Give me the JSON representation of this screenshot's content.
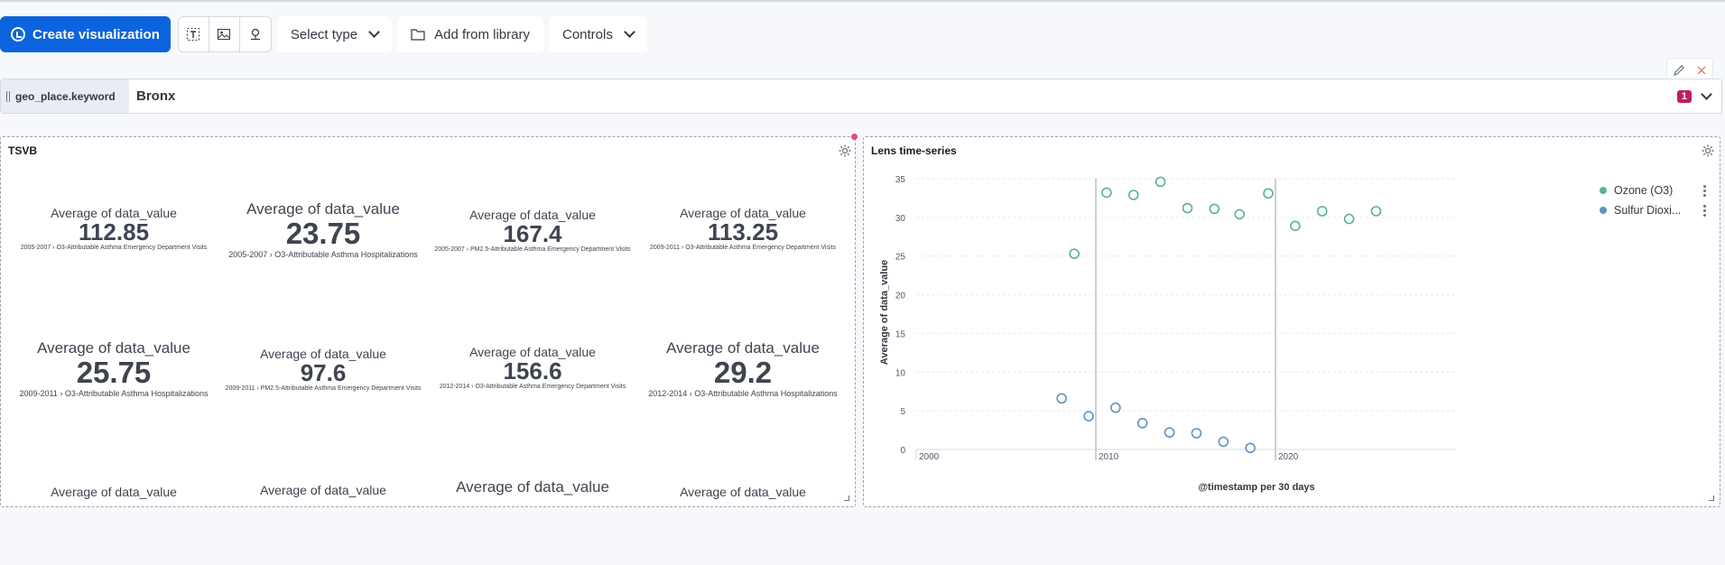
{
  "toolbar": {
    "create_label": "Create visualization",
    "select_type_label": "Select type",
    "add_library_label": "Add from library",
    "controls_label": "Controls"
  },
  "filter": {
    "field": "geo_place.keyword",
    "value": "Bronx",
    "count": "1"
  },
  "tsvb": {
    "title": "TSVB",
    "metrics": [
      {
        "label": "Average of data_value",
        "value": "112.85",
        "sub": "2005-2007 › O3-Attributable Asthma Emergency Department Visits"
      },
      {
        "label": "Average of data_value",
        "value": "23.75",
        "sub": "2005-2007 › O3-Attributable Asthma Hospitalizations"
      },
      {
        "label": "Average of data_value",
        "value": "167.4",
        "sub": "2005-2007 › PM2.5-Attributable Asthma Emergency Department Visits"
      },
      {
        "label": "Average of data_value",
        "value": "113.25",
        "sub": "2009-2011 › O3-Attributable Asthma Emergency Department Visits"
      },
      {
        "label": "Average of data_value",
        "value": "25.75",
        "sub": "2009-2011 › O3-Attributable Asthma Hospitalizations"
      },
      {
        "label": "Average of data_value",
        "value": "97.6",
        "sub": "2009-2011 › PM2.5-Attributable Asthma Emergency Department Visits"
      },
      {
        "label": "Average of data_value",
        "value": "156.6",
        "sub": "2012-2014 › O3-Attributable Asthma Emergency Department Visits"
      },
      {
        "label": "Average of data_value",
        "value": "29.2",
        "sub": "2012-2014 › O3-Attributable Asthma Hospitalizations"
      },
      {
        "label": "Average of data_value",
        "value": "",
        "sub": ""
      },
      {
        "label": "Average of data_value",
        "value": "",
        "sub": ""
      },
      {
        "label": "Average of data_value",
        "value": "",
        "sub": ""
      },
      {
        "label": "Average of data_value",
        "value": "",
        "sub": ""
      }
    ]
  },
  "lens": {
    "title": "Lens time-series",
    "legend": [
      {
        "name": "Ozone (O3)",
        "color": "#54b399"
      },
      {
        "name": "Sulfur Dioxi...",
        "color": "#6092c0"
      }
    ]
  },
  "chart_data": {
    "type": "scatter",
    "xlabel": "@timestamp per 30 days",
    "ylabel": "Average of data_value",
    "x_ticks": [
      "2000",
      "2010",
      "2020"
    ],
    "y_ticks": [
      0,
      5,
      10,
      15,
      20,
      25,
      30,
      35
    ],
    "xlim": [
      2000,
      2030
    ],
    "ylim": [
      0,
      35
    ],
    "grid": true,
    "legend_position": "top-right",
    "series": [
      {
        "name": "Ozone (O3)",
        "color": "#54b399",
        "points": [
          [
            2008.8,
            25.3
          ],
          [
            2010.6,
            33.2
          ],
          [
            2012.1,
            32.9
          ],
          [
            2013.6,
            34.6
          ],
          [
            2015.1,
            31.2
          ],
          [
            2016.6,
            31.1
          ],
          [
            2018.0,
            30.4
          ],
          [
            2019.6,
            33.1
          ],
          [
            2021.1,
            28.9
          ],
          [
            2022.6,
            30.8
          ],
          [
            2024.1,
            29.8
          ],
          [
            2025.6,
            30.8
          ]
        ]
      },
      {
        "name": "Sulfur Dioxi...",
        "color": "#6092c0",
        "points": [
          [
            2008.1,
            6.6
          ],
          [
            2009.6,
            4.3
          ],
          [
            2011.1,
            5.4
          ],
          [
            2012.6,
            3.4
          ],
          [
            2014.1,
            2.2
          ],
          [
            2015.6,
            2.1
          ],
          [
            2017.1,
            1.0
          ],
          [
            2018.6,
            0.2
          ]
        ]
      }
    ]
  }
}
